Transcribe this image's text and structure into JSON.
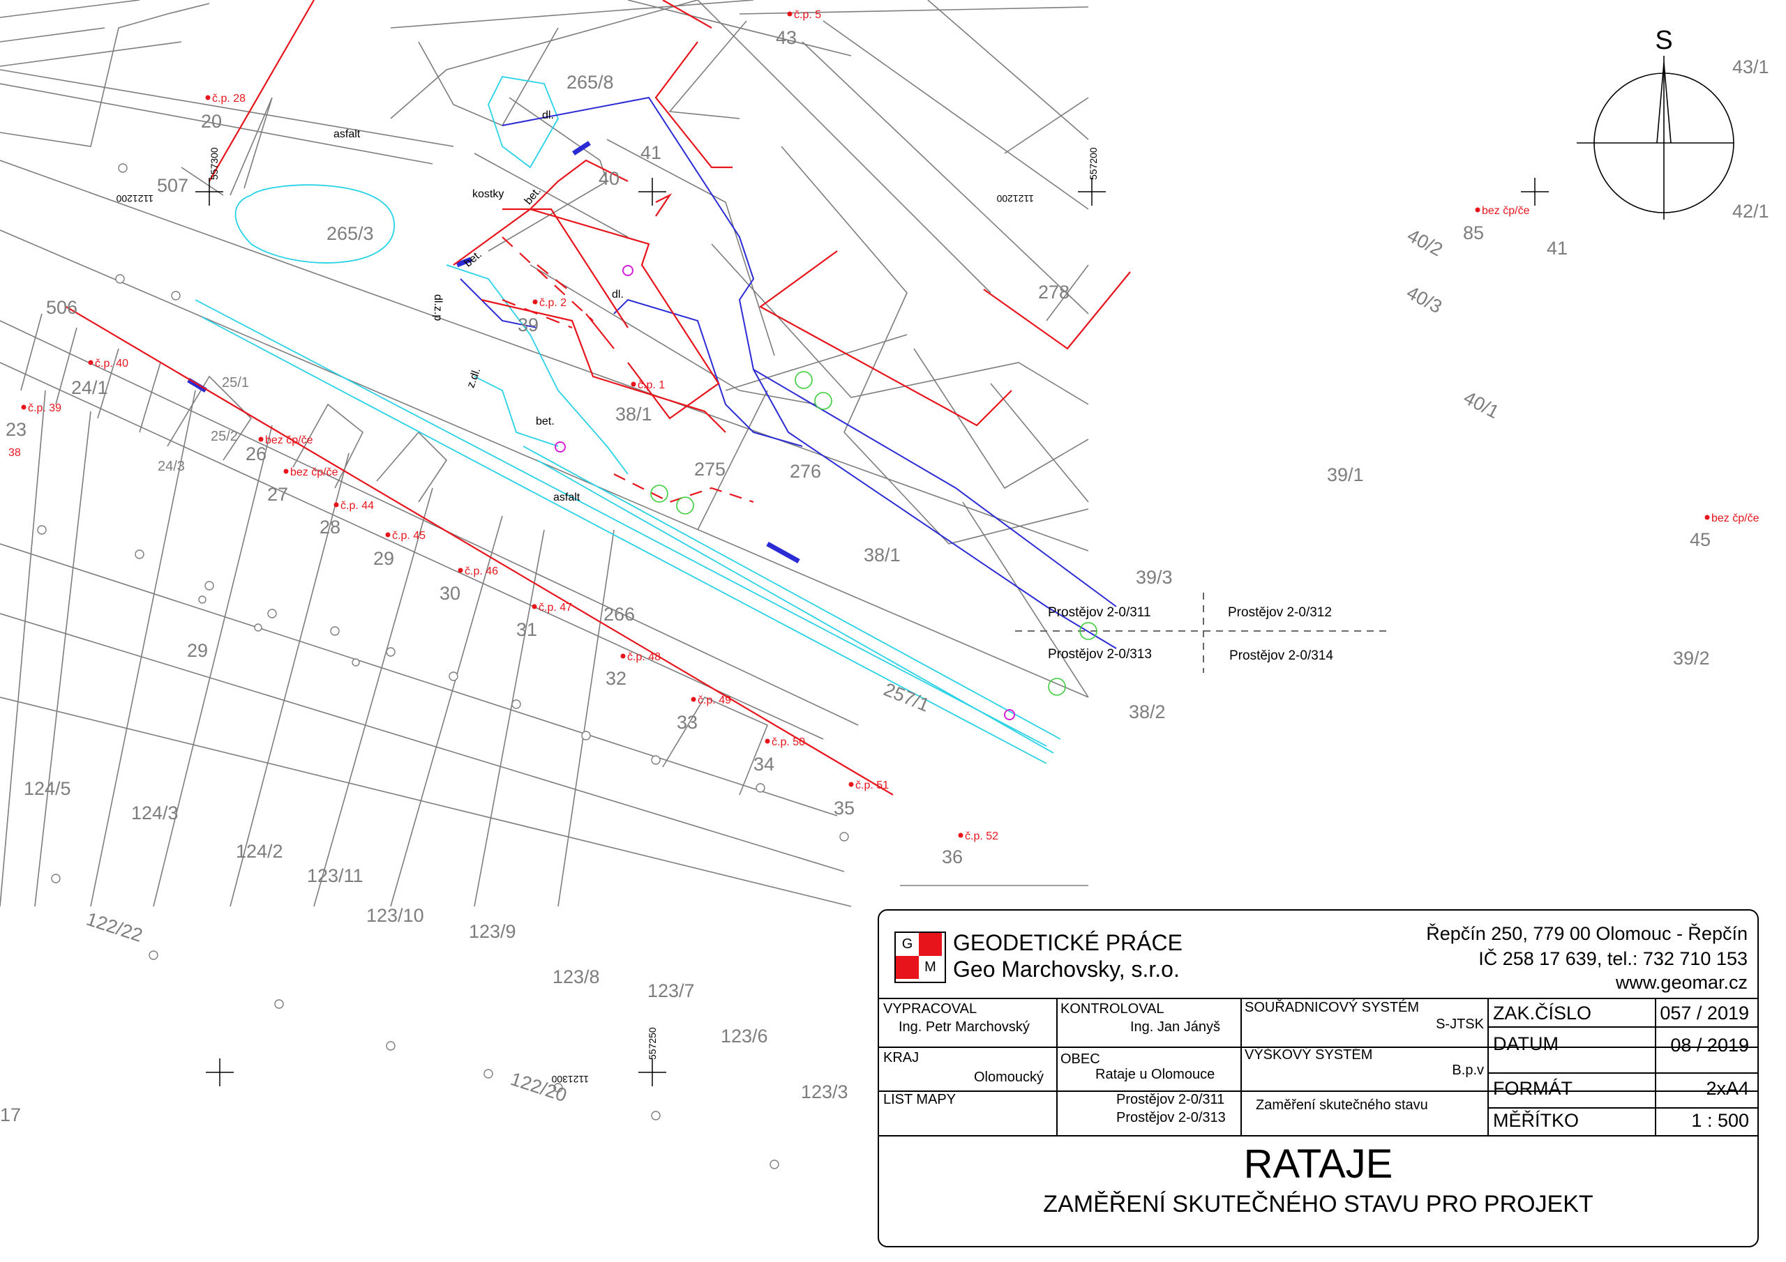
{
  "map": {
    "north_label": "S",
    "parcels": [
      "20",
      "43",
      "41",
      "40",
      "265/8",
      "265/3",
      "39",
      "38/1",
      "275",
      "276",
      "278",
      "85",
      "41",
      "43/1",
      "42/1",
      "40/2",
      "40/3",
      "40/1",
      "39/1",
      "39/3",
      "45",
      "39/2",
      "38/1",
      "38/2",
      "24/1",
      "23",
      "26",
      "27",
      "28",
      "29",
      "30",
      "31",
      "266",
      "29",
      "32",
      "33",
      "34",
      "35",
      "36",
      "257/1",
      "124/5",
      "124/3",
      "124/2",
      "123/11",
      "123/10",
      "123/9",
      "123/8",
      "123/7",
      "123/6",
      "123/3",
      "122/22",
      "122/20",
      "506",
      "507",
      "17"
    ],
    "small_parcels": [
      "25/1",
      "25/2",
      "24/3"
    ],
    "house_numbers": [
      "č.p. 5",
      "č.p. 28",
      "č.p. 40",
      "č.p. 39",
      "38",
      "bez čp/če",
      "bez čp/če",
      "č.p. 44",
      "č.p. 45",
      "č.p. 46",
      "č.p. 47",
      "č.p. 48",
      "č.p. 49",
      "č.p. 50",
      "č.p. 51",
      "č.p. 52",
      "č.p. 2",
      "č.p. 1",
      "bez čp/če",
      "bez čp/če"
    ],
    "surface_notes": [
      "asfalt",
      "asfalt",
      "kostky",
      "bet.",
      "bet.",
      "bet.",
      "dl.",
      "dl.",
      "z.dl.",
      "dl.z.p"
    ],
    "coordinates": [
      "557300",
      "1121200",
      "557200",
      "1121200",
      "557250",
      "1121300"
    ],
    "sheets": [
      "Prostějov 2-0/311",
      "Prostějov 2-0/312",
      "Prostějov 2-0/313",
      "Prostějov 2-0/314"
    ],
    "colors": {
      "boundary_red": "#e8141b",
      "utility_blue": "#2b2bd6",
      "cyan": "#28d2e6",
      "green": "#3ccd3c",
      "grey": "#7d7d7d"
    }
  },
  "titleblock": {
    "company_line1": "GEODETICKÉ PRÁCE",
    "company_line2": "Geo Marchovsky, s.r.o.",
    "logo_top": "G",
    "logo_bottom": "M",
    "address": "Řepčín 250, 779 00 Olomouc - Řepčín",
    "ico": "IČ 258 17 639, tel.: 732 710 153",
    "web": "www.geomar.cz",
    "vypracoval_label": "VYPRACOVAL",
    "vypracoval_value": "Ing. Petr Marchovský",
    "kontroloval_label": "KONTROLOVAL",
    "kontroloval_value": "Ing. Jan Jányš",
    "souradnicovy_label": "SOUŘADNICOVÝ SYSTÉM",
    "souradnicovy_value": "S-JTSK",
    "kraj_label": "KRAJ",
    "kraj_value": "Olomoucký",
    "obec_label": "OBEC",
    "obec_value": "Rataje u Olomouce",
    "vyskovy_label": "VÝŠKOVÝ SYSTÉM",
    "vyskovy_value": "B.p.v",
    "list_label": "LIST MAPY",
    "list_value1": "Prostějov 2-0/311",
    "list_value2": "Prostějov 2-0/313",
    "purpose": "Zaměření skutečného stavu",
    "zak_label": "ZAK.ČÍSLO",
    "zak_value": "057 / 2019",
    "datum_label": "DATUM",
    "datum_value": "08 / 2019",
    "format_label": "FORMÁT",
    "format_value": "2xA4",
    "meritko_label": "MĚŘÍTKO",
    "meritko_value": "1 : 500",
    "main_title": "RATAJE",
    "subtitle": "ZAMĚŘENÍ SKUTEČNÉHO STAVU PRO PROJEKT"
  }
}
